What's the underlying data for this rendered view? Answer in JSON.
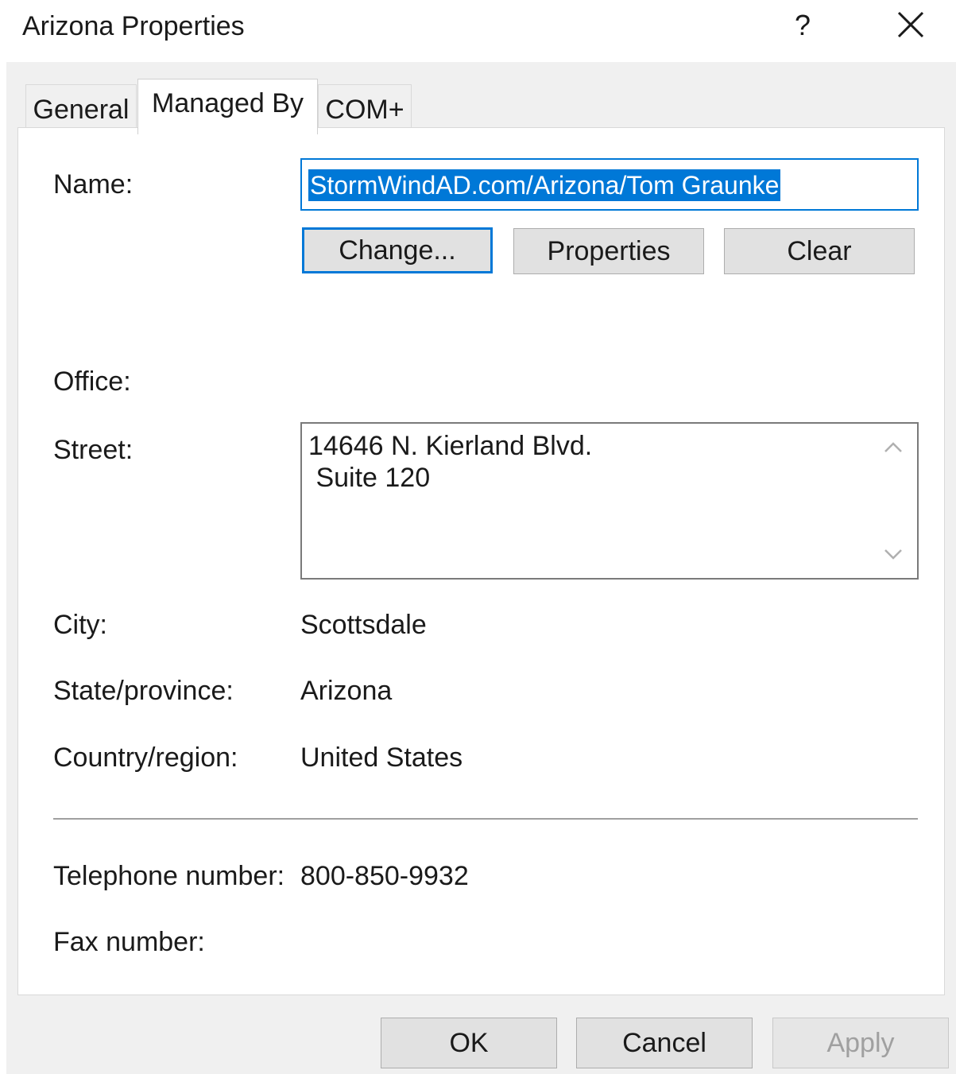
{
  "window": {
    "title": "Arizona Properties",
    "help_glyph": "?",
    "close_icon": "close-icon"
  },
  "tabs": [
    {
      "label": "General",
      "selected": false
    },
    {
      "label": "Managed By",
      "selected": true
    },
    {
      "label": "COM+",
      "selected": false
    }
  ],
  "managed_by": {
    "name_label": "Name:",
    "name_value": "StormWindAD.com/Arizona/Tom Graunke",
    "buttons": {
      "change": "Change...",
      "properties": "Properties",
      "clear": "Clear"
    },
    "office_label": "Office:",
    "street_label": "Street:",
    "street_line1": "14646 N. Kierland Blvd.",
    "street_line2": " Suite 120",
    "city_label": "City:",
    "city_value": "Scottsdale",
    "state_label": "State/province:",
    "state_value": "Arizona",
    "country_label": "Country/region:",
    "country_value": "United States",
    "phone_label": "Telephone number:",
    "phone_value": "800-850-9932",
    "fax_label": "Fax number:"
  },
  "footer": {
    "ok": "OK",
    "cancel": "Cancel",
    "apply": "Apply"
  },
  "colors": {
    "accent": "#0078d7",
    "dialog_bg": "#f0f0f0",
    "page_bg": "#ffffff"
  }
}
